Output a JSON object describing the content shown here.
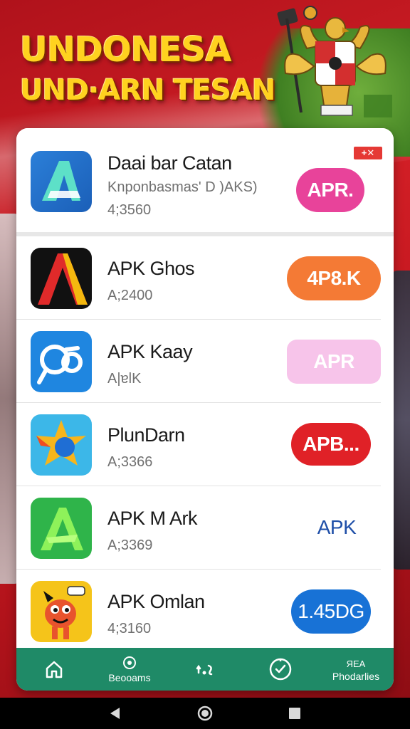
{
  "banner": {
    "line1": "UNDONESA",
    "line2": "UND·ARN TESAN"
  },
  "featured": {
    "title": "Daai bar Catan",
    "subtitle": "Knponbasmas' D )AKS)",
    "meta": "4;3560",
    "button": "APR.",
    "ad_badge": "+✕",
    "colors": {
      "button": "#e8439a"
    }
  },
  "apps": [
    {
      "title": "APK Ghos",
      "meta": "A;2400",
      "button": "4P8.K",
      "icon": "letter-a-icon",
      "button_color": "#f47a35"
    },
    {
      "title": "APK Kaay",
      "meta": "A|ɐlK",
      "button": "APR",
      "icon": "link-icon",
      "button_color": "#f7c4ea"
    },
    {
      "title": "PlunDarn",
      "meta": "A;3366",
      "button": "APB...",
      "icon": "star-icon",
      "button_color": "#e02127"
    },
    {
      "title": "APK M Ark",
      "meta": "A;3369",
      "button": "APK",
      "icon": "green-a-icon",
      "button_color": "transparent"
    },
    {
      "title": "APK Omlan",
      "meta": "4;3160",
      "button": "1.45DG",
      "icon": "mascot-icon",
      "button_color": "#1872d6"
    }
  ],
  "nav": {
    "items": [
      {
        "label": "",
        "icon": "home-icon"
      },
      {
        "label": "Beooams",
        "icon": "record-icon"
      },
      {
        "label": "",
        "icon": "sync-icon"
      },
      {
        "label": "",
        "icon": "clock-check-icon"
      },
      {
        "label_top": "ЯEA",
        "label": "Phodarlies",
        "icon": "text-icon"
      }
    ]
  }
}
